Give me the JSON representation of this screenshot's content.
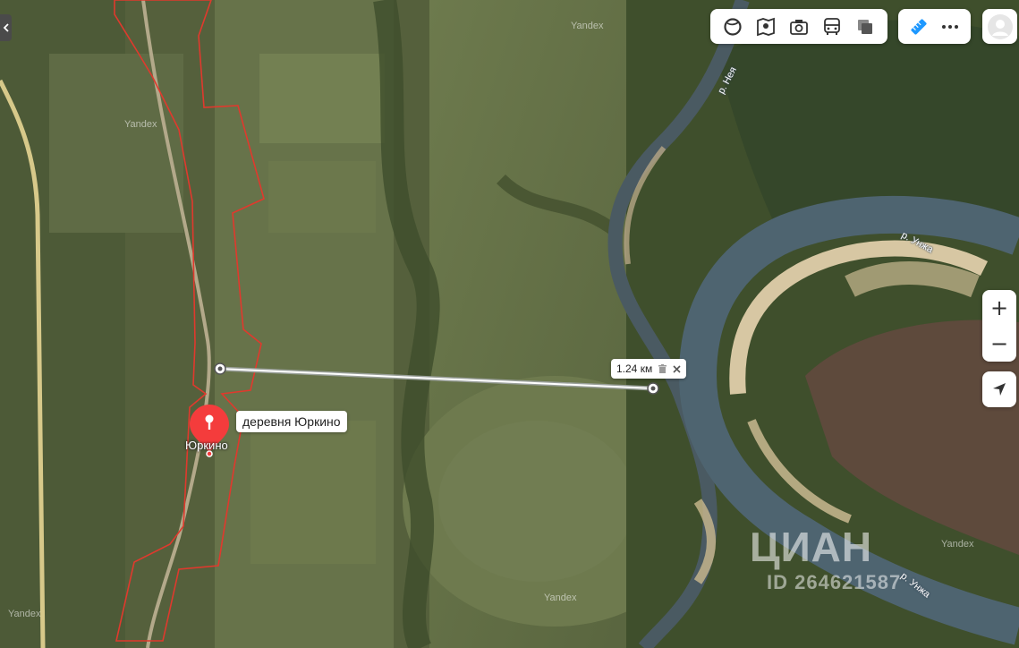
{
  "map": {
    "watermark": "Yandex",
    "rivers": {
      "neya": "р. Нея",
      "unzha": "р. Унжа"
    }
  },
  "ruler": {
    "distance": "1.24 км"
  },
  "place": {
    "popup": "деревня Юркино",
    "town_label": "Юркино"
  },
  "overlay": {
    "brand": "ЦИАН",
    "listing_id": "ID 264621587"
  },
  "colors": {
    "pin": "#f43c3c",
    "boundary": "#e0392d",
    "ruler_line": "#ffffff",
    "accent": "#1e98ff"
  },
  "toolbar": {
    "layers": [
      "traffic-icon",
      "panorama-icon",
      "photo-icon",
      "transport-icon",
      "layers-icon"
    ],
    "tools": [
      "ruler-icon",
      "more-icon"
    ]
  },
  "controls": {
    "zoom_in": "+",
    "zoom_out": "−"
  }
}
